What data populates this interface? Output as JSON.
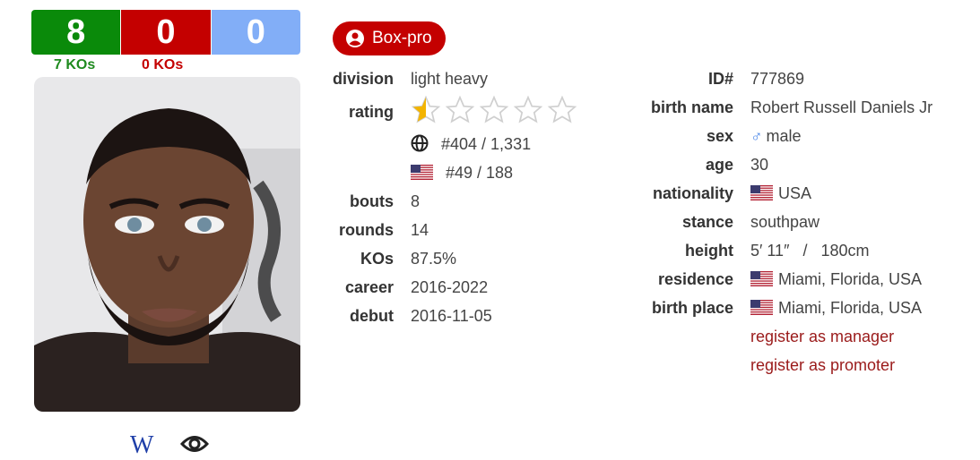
{
  "record": {
    "wins": "8",
    "losses": "0",
    "draws": "0",
    "win_kos": "7 KOs",
    "loss_kos": "0 KOs"
  },
  "badge": {
    "label": "Box-pro"
  },
  "colors": {
    "win": "#0a8a0a",
    "loss": "#c40000",
    "draw": "#82aef7",
    "link": "#9a1a1a"
  },
  "left": {
    "division_label": "division",
    "division": "light heavy",
    "rating_label": "rating",
    "rating_stars": 0.5,
    "rating_max": 5,
    "world_rank": "#404 / 1,331",
    "country_rank": "#49 / 188",
    "bouts_label": "bouts",
    "bouts": "8",
    "rounds_label": "rounds",
    "rounds": "14",
    "kos_label": "KOs",
    "kos": "87.5%",
    "career_label": "career",
    "career": "2016-2022",
    "debut_label": "debut",
    "debut": "2016-11-05"
  },
  "right": {
    "id_label": "ID#",
    "id": "777869",
    "birth_name_label": "birth name",
    "birth_name": "Robert Russell Daniels Jr",
    "sex_label": "sex",
    "sex": "male",
    "age_label": "age",
    "age": "30",
    "nationality_label": "nationality",
    "nationality": "USA",
    "stance_label": "stance",
    "stance": "southpaw",
    "height_label": "height",
    "height": "5′ 11″   /   180cm",
    "residence_label": "residence",
    "residence": "Miami, Florida, USA",
    "birth_place_label": "birth place",
    "birth_place": "Miami, Florida, USA",
    "register_manager": "register as manager",
    "register_promoter": "register as promoter"
  },
  "icons": {
    "wiki": "W",
    "eye": "eye-icon"
  }
}
